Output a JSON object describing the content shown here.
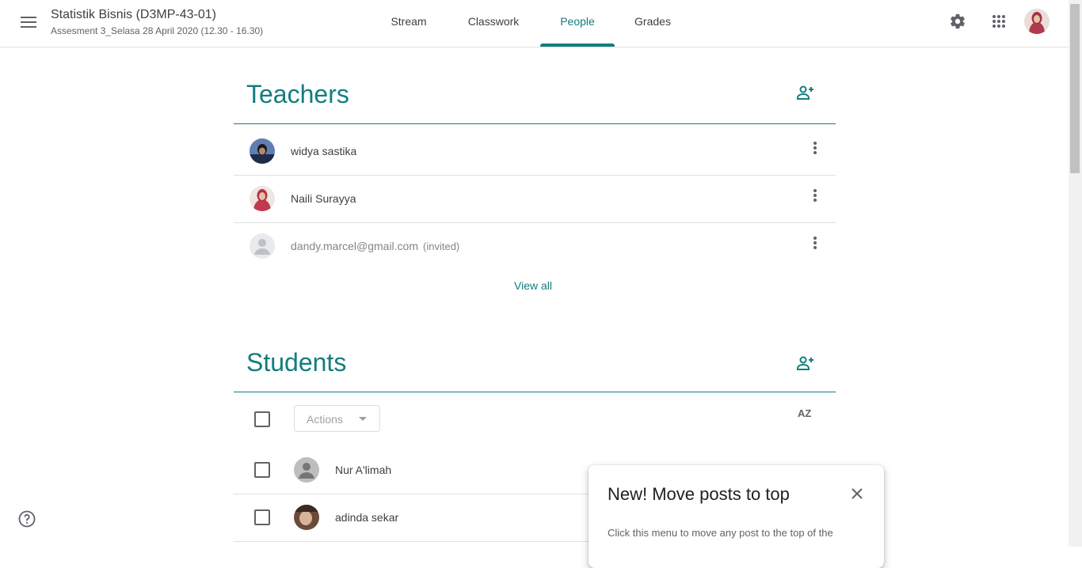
{
  "header": {
    "menu_icon": "hamburger-menu-icon",
    "class_title": "Statistik Bisnis (D3MP-43-01)",
    "class_subtitle": "Assesment 3_Selasa 28 April 2020 (12.30 - 16.30)",
    "tabs": [
      {
        "label": "Stream",
        "active": false
      },
      {
        "label": "Classwork",
        "active": false
      },
      {
        "label": "People",
        "active": true
      },
      {
        "label": "Grades",
        "active": false
      }
    ],
    "accent_color": "#137d7d"
  },
  "teachers": {
    "title": "Teachers",
    "list": [
      {
        "name": "widya sastika",
        "status": ""
      },
      {
        "name": "Naili Surayya",
        "status": ""
      },
      {
        "name": "dandy.marcel@gmail.com",
        "status": "(invited)"
      }
    ],
    "view_all": "View all"
  },
  "students": {
    "title": "Students",
    "actions_label": "Actions",
    "sort_label": "AZ",
    "list": [
      {
        "name": "Nur A'limah"
      },
      {
        "name": "adinda sekar"
      }
    ]
  },
  "popup": {
    "title": "New! Move posts to top",
    "body": "Click this menu to move any post to the top of the"
  }
}
